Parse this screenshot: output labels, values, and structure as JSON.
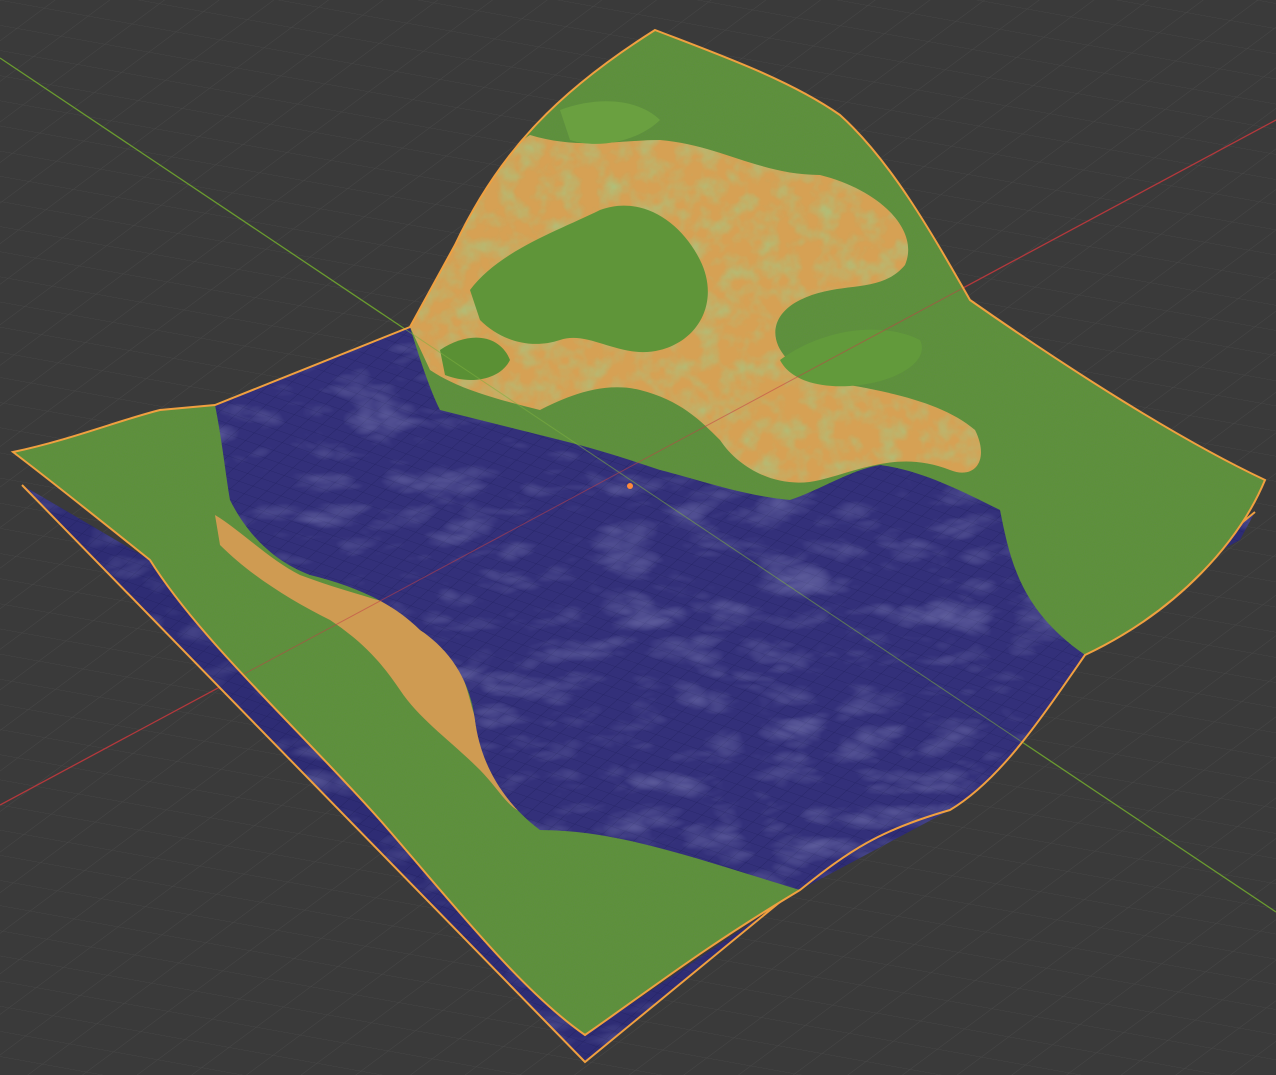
{
  "viewport": {
    "colors": {
      "background": "#3a3a3a",
      "grid": "#4a4a4a",
      "x_axis": "#b3383c",
      "y_axis": "#6a9b2f",
      "selection_outline": "#f0a040",
      "origin": "#ff8a3a",
      "grass": "#5e9438",
      "grass_dark": "#3f7a2c",
      "sand": "#d9a355",
      "water": "#34317a",
      "water_dark": "#21206a",
      "water_highlight": "#7c7db5"
    },
    "objects": [
      "terrain-mesh",
      "water-plane"
    ],
    "icons": [
      "origin-icon"
    ]
  }
}
